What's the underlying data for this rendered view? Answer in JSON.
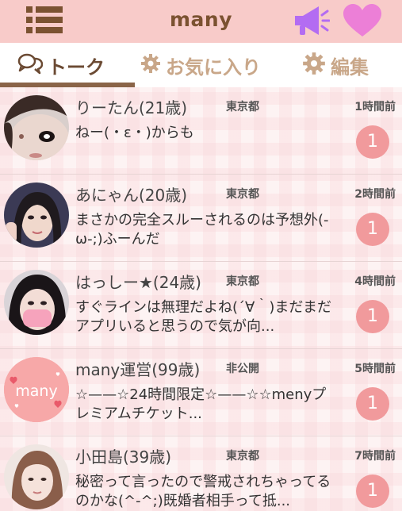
{
  "header": {
    "title": "many",
    "menu_icon": "menu-icon",
    "megaphone_icon": "megaphone-icon",
    "heart_icon": "heart-icon",
    "accent_color": "#f8cbc9",
    "icon_color": "#b36cf2",
    "heart_color": "#ec7fd7"
  },
  "tabs": [
    {
      "label": "トーク",
      "icon": "chat-bubbles-icon",
      "active": true
    },
    {
      "label": "お気に入り",
      "icon": "gear-icon",
      "active": false
    },
    {
      "label": "編集",
      "icon": "gear-icon",
      "active": false
    }
  ],
  "conversations": [
    {
      "name": "りーたん(21歳)",
      "prefecture": "東京都",
      "time": "1時間前",
      "message": "ねー(・ε・)からも",
      "unread": "1"
    },
    {
      "name": "あにゃん(20歳)",
      "prefecture": "東京都",
      "time": "2時間前",
      "message": "まさかの完全スルーされるのは予想外(-ω-;)ふーんだ",
      "unread": "1"
    },
    {
      "name": "はっしー★(24歳)",
      "prefecture": "東京都",
      "time": "4時間前",
      "message": "すぐラインは無理だよね(´∀｀)まだまだアプリいると思うので気が向...",
      "unread": "1"
    },
    {
      "name": "many運営(99歳)",
      "prefecture": "非公開",
      "time": "5時間前",
      "message": "☆——☆24時間限定☆——☆☆menyプレミアムチケット...",
      "unread": "1",
      "avatar_text": "many"
    },
    {
      "name": "小田島(39歳)",
      "prefecture": "東京都",
      "time": "7時間前",
      "message": "秘密って言ったので警戒されちゃってるのかな(^-^;)既婚者相手って抵...",
      "unread": "1"
    }
  ],
  "badge_color": "#f19a9c"
}
